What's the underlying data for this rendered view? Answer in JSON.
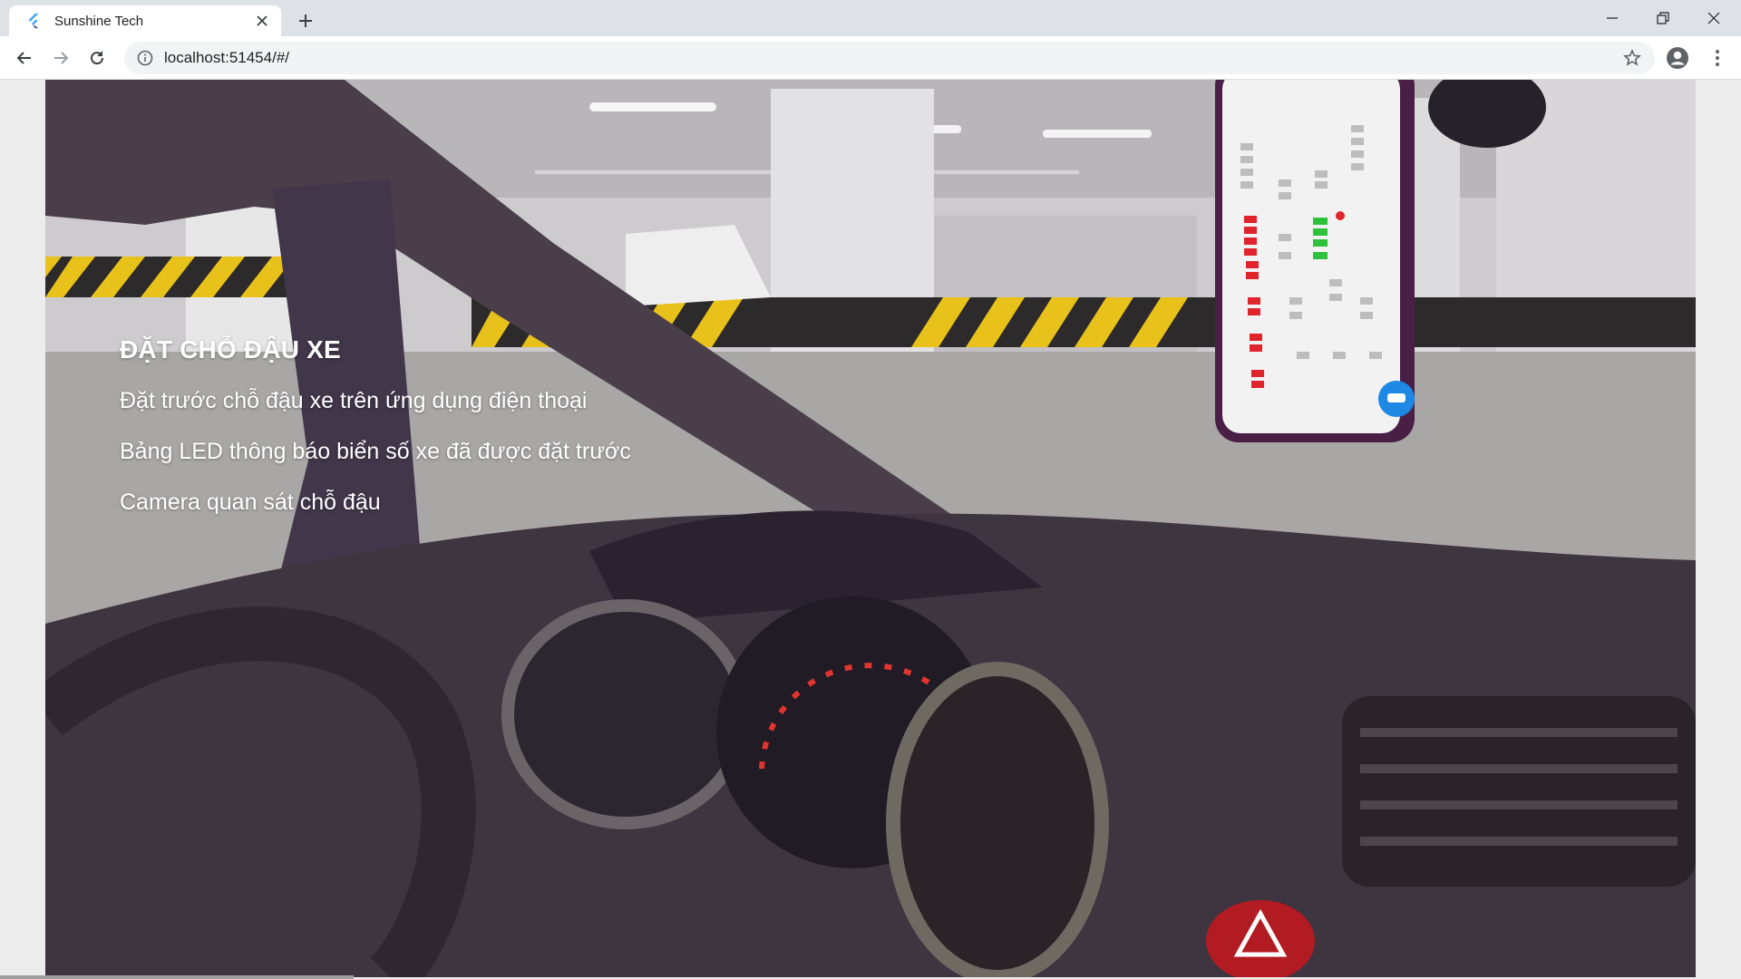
{
  "browser": {
    "tab": {
      "title": "Sunshine Tech",
      "favicon": "flutter-icon"
    },
    "address_bar": {
      "url": "localhost:51454/#/"
    },
    "icons": {
      "back": "arrow-left-icon",
      "forward": "arrow-right-icon",
      "reload": "reload-icon",
      "site_info": "info-icon",
      "bookmark": "star-icon",
      "profile": "account-icon",
      "menu": "kebab-menu-icon",
      "new_tab": "plus-icon",
      "close_tab": "close-icon",
      "window_minimize": "minimize-icon",
      "window_restore": "restore-icon",
      "window_close": "close-icon"
    }
  },
  "hero": {
    "title": "ĐẶT CHỖ ĐẬU XE",
    "features": [
      "Đặt trước chỗ đậu xe trên ứng dụng điện thoại",
      "Bảng LED thông báo biển số xe đã được đặt trước",
      "Camera quan sát chỗ đậu"
    ]
  },
  "colors": {
    "tab_strip": "#dee1e6",
    "toolbar": "#ffffff",
    "omnibox": "#f1f3f4",
    "hero_text": "#ffffff",
    "parking_stripe_yellow": "#e8c21a",
    "slot_booked": "#e0242c",
    "slot_available": "#2ec13c",
    "car_button": "#1e88e5"
  }
}
